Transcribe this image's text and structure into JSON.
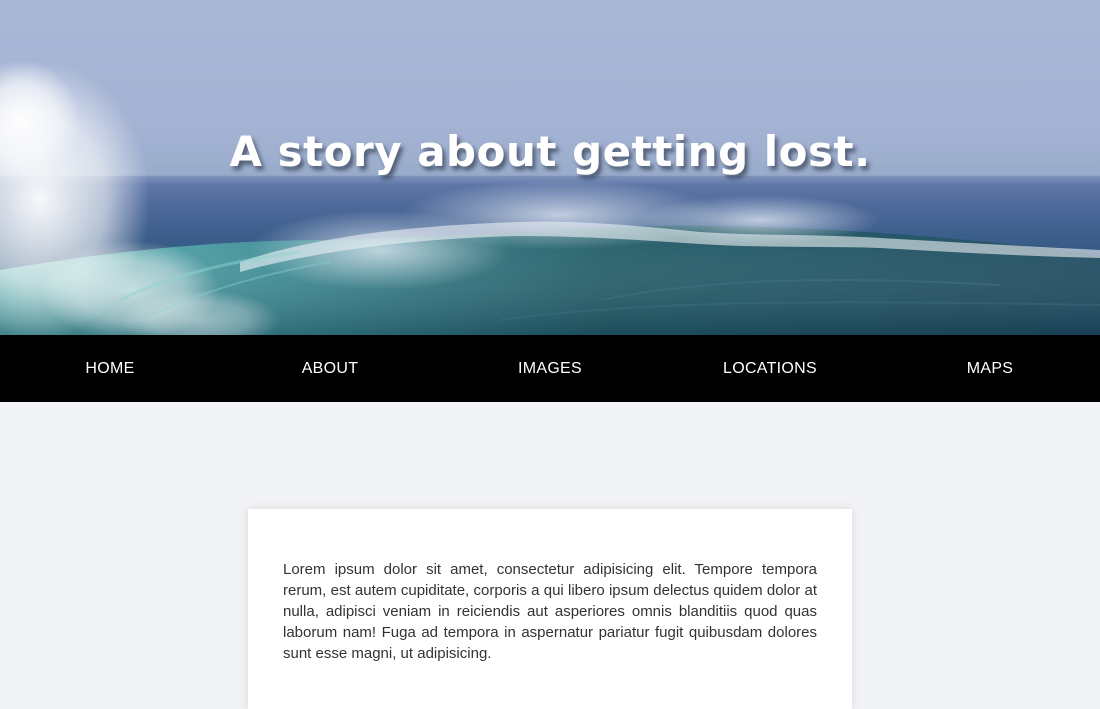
{
  "hero": {
    "title": "A story about getting lost."
  },
  "nav": {
    "items": [
      {
        "label": "HOME"
      },
      {
        "label": "ABOUT"
      },
      {
        "label": "IMAGES"
      },
      {
        "label": "LOCATIONS"
      },
      {
        "label": "MAPS"
      }
    ]
  },
  "card": {
    "text": "Lorem ipsum dolor sit amet, consectetur adipisicing elit. Tempore tempora rerum, est autem cupiditate, corporis a qui libero ipsum delectus quidem dolor at nulla, adipisci veniam in reiciendis aut asperiores omnis blanditiis quod quas laborum nam! Fuga ad tempora in aspernatur pariatur fugit quibusdam dolores sunt esse magni, ut adipisicing."
  },
  "colors": {
    "nav_background": "#000000",
    "page_background": "#f2f3f6",
    "sky": "#a9b8d7",
    "ocean": "#2f5479"
  }
}
